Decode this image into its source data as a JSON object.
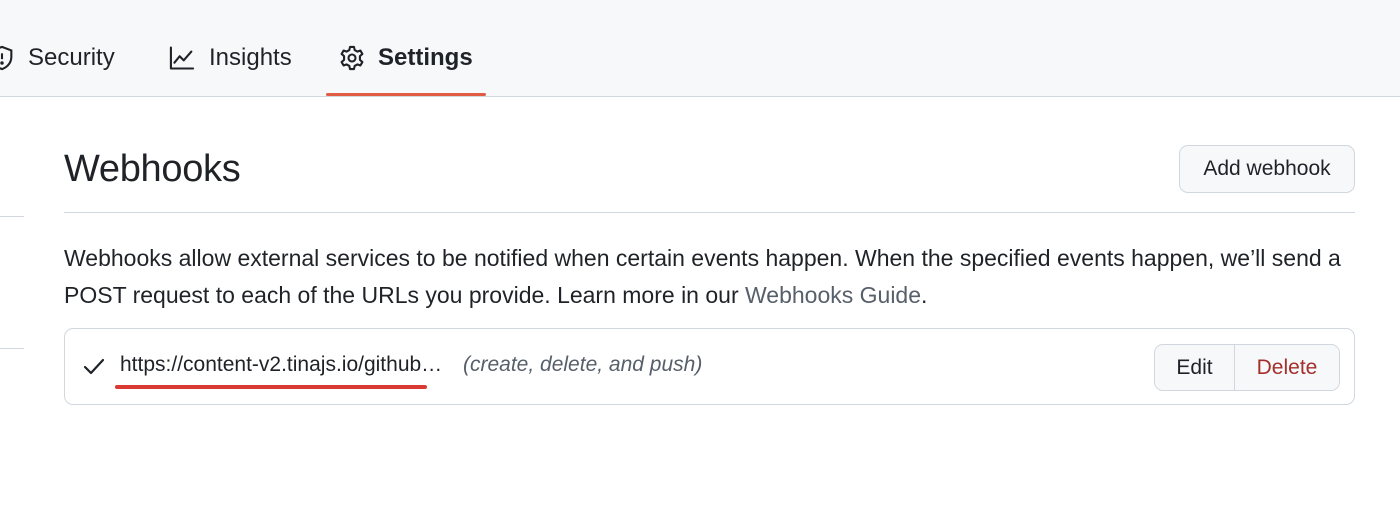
{
  "nav": {
    "items": [
      {
        "label": "Security",
        "icon": "shield-icon"
      },
      {
        "label": "Insights",
        "icon": "graph-icon"
      },
      {
        "label": "Settings",
        "icon": "gear-icon",
        "active": true
      }
    ],
    "active_underline_color": "#e05d44"
  },
  "page": {
    "title": "Webhooks",
    "add_button_label": "Add webhook",
    "description_text": "Webhooks allow external services to be notified when certain events happen. When the specified events happen, we’ll send a POST request to each of the URLs you provide. Learn more in our ",
    "guide_link_label": "Webhooks Guide",
    "description_end": "."
  },
  "webhooks": [
    {
      "status_icon": "check-icon",
      "url": "https://content-v2.tinajs.io/github…",
      "events": "(create, delete, and push)",
      "edit_label": "Edit",
      "delete_label": "Delete",
      "highlight_color": "#d93a33"
    }
  ]
}
